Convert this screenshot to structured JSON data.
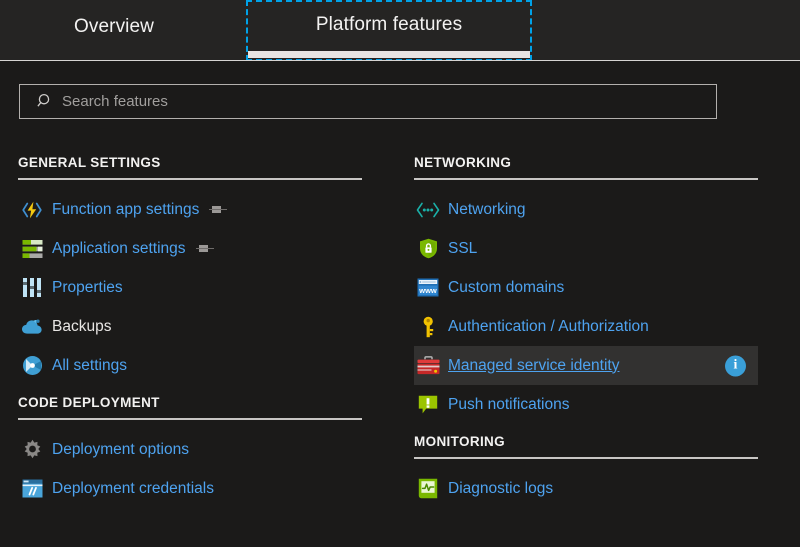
{
  "tabs": [
    {
      "label": "Overview",
      "active": false
    },
    {
      "label": "Platform features",
      "active": true
    }
  ],
  "search": {
    "placeholder": "Search features",
    "value": "",
    "icon": "search-icon"
  },
  "columns": {
    "left": [
      {
        "title": "GENERAL SETTINGS",
        "items": [
          {
            "label": "Function app settings",
            "icon": "function-app-icon",
            "link": true,
            "pin": true
          },
          {
            "label": "Application settings",
            "icon": "application-settings-icon",
            "link": true,
            "pin": true
          },
          {
            "label": "Properties",
            "icon": "properties-icon",
            "link": true,
            "pin": false
          },
          {
            "label": "Backups",
            "icon": "backups-cloud-icon",
            "link": false,
            "pin": false
          },
          {
            "label": "All settings",
            "icon": "all-settings-icon",
            "link": true,
            "pin": false
          }
        ]
      },
      {
        "title": "CODE DEPLOYMENT",
        "items": [
          {
            "label": "Deployment options",
            "icon": "gear-icon",
            "link": true,
            "pin": false
          },
          {
            "label": "Deployment credentials",
            "icon": "deployment-credentials-icon",
            "link": true,
            "pin": false
          }
        ]
      }
    ],
    "right": [
      {
        "title": "NETWORKING",
        "items": [
          {
            "label": "Networking",
            "icon": "networking-icon",
            "link": true,
            "pin": false
          },
          {
            "label": "SSL",
            "icon": "ssl-shield-icon",
            "link": true,
            "pin": false
          },
          {
            "label": "Custom domains",
            "icon": "custom-domains-icon",
            "link": true,
            "pin": false
          },
          {
            "label": "Authentication / Authorization",
            "icon": "key-icon",
            "link": true,
            "pin": false
          },
          {
            "label": "Managed service identity",
            "icon": "toolbox-icon",
            "link": true,
            "pin": false,
            "hovered": true,
            "info": "i"
          },
          {
            "label": "Push notifications",
            "icon": "push-notifications-icon",
            "link": true,
            "pin": false
          }
        ]
      },
      {
        "title": "MONITORING",
        "items": [
          {
            "label": "Diagnostic logs",
            "icon": "diagnostic-logs-icon",
            "link": true,
            "pin": false
          }
        ]
      }
    ]
  },
  "colors": {
    "background": "#1b1a19",
    "tab_background": "#252423",
    "link": "#4ea3f0",
    "focus_outline": "#00a2e8",
    "active_tab_bar": "#e6e4e2",
    "hover_row": "#323130",
    "rule": "#c8c6c4",
    "info_badge": "#3a9fd8"
  }
}
